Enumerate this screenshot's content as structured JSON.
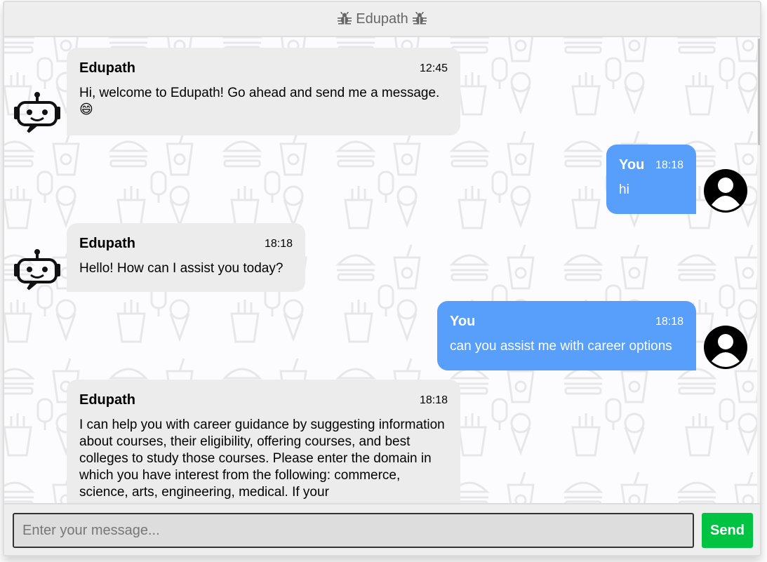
{
  "header": {
    "title": "Edupath",
    "left_icon": "bug-icon",
    "right_icon": "bug-icon"
  },
  "messages": [
    {
      "side": "left",
      "name": "Edupath",
      "time": "12:45",
      "text": "Hi, welcome to Edupath! Go ahead and send me a message. 😄",
      "avatar": "robot-icon"
    },
    {
      "side": "right",
      "name": "You",
      "time": "18:18",
      "text": "hi",
      "avatar": "user-icon"
    },
    {
      "side": "left",
      "name": "Edupath",
      "time": "18:18",
      "text": "Hello! How can I assist you today?",
      "avatar": "robot-icon"
    },
    {
      "side": "right",
      "name": "You",
      "time": "18:18",
      "text": "can you assist me with career options",
      "avatar": "user-icon"
    },
    {
      "side": "left",
      "name": "Edupath",
      "time": "18:18",
      "text": "I can help you with career guidance by suggesting information about courses, their eligibility, offering courses, and best colleges to study those courses. Please enter the domain in which you have interest from the following: commerce, science, arts, engineering, medical. If your",
      "avatar": "robot-icon"
    }
  ],
  "input": {
    "placeholder": "Enter your message...",
    "value": ""
  },
  "send_button": {
    "label": "Send"
  },
  "colors": {
    "bot_bubble": "#ececec",
    "user_bubble": "#579ffb",
    "send": "#00c441"
  }
}
